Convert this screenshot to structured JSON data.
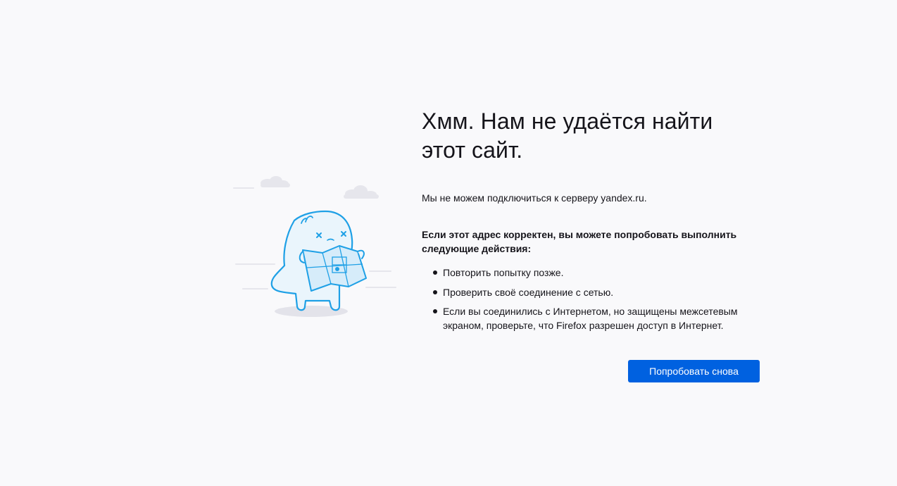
{
  "error": {
    "title": "Хмм. Нам не удаётся найти этот сайт.",
    "description": "Мы не можем подключиться к серверу yandex.ru.",
    "advice_heading": "Если этот адрес корректен, вы можете попробовать выполнить следующие действия:",
    "advice_items": [
      "Повторить попытку позже.",
      "Проверить своё соединение с сетью.",
      "Если вы соединились с Интернетом, но защищены межсетевым экраном, проверьте, что Firefox разрешен доступ в Интернет."
    ],
    "retry_label": "Попробовать снова"
  },
  "colors": {
    "background": "#f9f9fb",
    "text": "#15141a",
    "button": "#0061e0",
    "illustration_stroke": "#1ea0e6"
  },
  "icons": {
    "illustration": "confused-creature-with-map-illustration"
  }
}
